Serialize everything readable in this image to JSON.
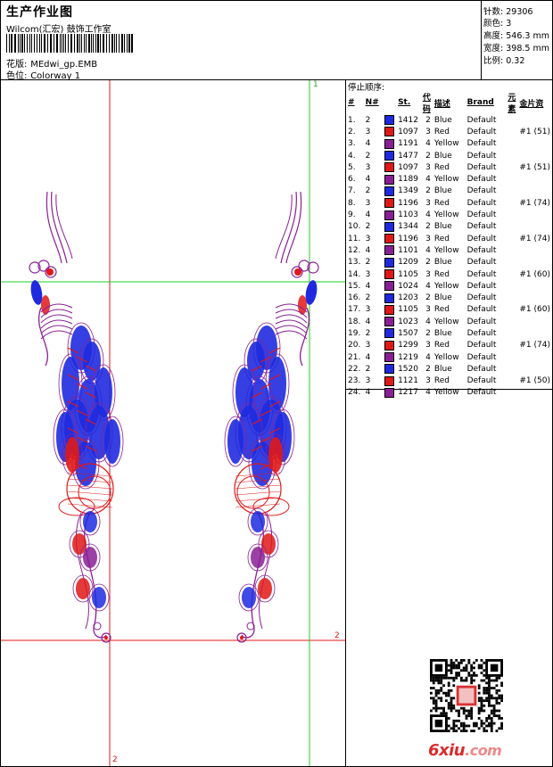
{
  "header": {
    "title": "生产作业图",
    "company": "Wilcom(汇宏) 鼓饰工作室",
    "design_label": "花版:",
    "design_value": "MEdwi_gp.EMB",
    "colorway_label": "色位:",
    "colorway_value": "Colorway 1"
  },
  "stats": {
    "stitches_label": "针数:",
    "stitches_value": "29306",
    "colors_label": "颜色:",
    "colors_value": "3",
    "height_label": "高度:",
    "height_value": "546.3 mm",
    "width_label": "宽度:",
    "width_value": "398.5 mm",
    "scale_label": "比例:",
    "scale_value": "0.32"
  },
  "canvas": {
    "marker_top": "1",
    "marker_right": "2",
    "marker_bottom": "2"
  },
  "stop_list": {
    "title": "停止顺序:",
    "headers": {
      "idx": "#",
      "n": "N#",
      "st": "St.",
      "code": "代码",
      "desc": "描述",
      "brand": "Brand",
      "element": "元素",
      "sequin": "金片资"
    },
    "rows": [
      {
        "idx": "1.",
        "n": "2",
        "color": "#1f2adf",
        "st": "1412",
        "code": "2",
        "desc": "Blue",
        "brand": "Default",
        "sequin": ""
      },
      {
        "idx": "2.",
        "n": "3",
        "color": "#e01818",
        "st": "1097",
        "code": "3",
        "desc": "Red",
        "brand": "Default",
        "sequin": "#1 (51)"
      },
      {
        "idx": "3.",
        "n": "4",
        "color": "#8a1f95",
        "st": "1191",
        "code": "4",
        "desc": "Yellow",
        "brand": "Default",
        "sequin": ""
      },
      {
        "idx": "4.",
        "n": "2",
        "color": "#1f2adf",
        "st": "1477",
        "code": "2",
        "desc": "Blue",
        "brand": "Default",
        "sequin": ""
      },
      {
        "idx": "5.",
        "n": "3",
        "color": "#e01818",
        "st": "1097",
        "code": "3",
        "desc": "Red",
        "brand": "Default",
        "sequin": "#1 (51)"
      },
      {
        "idx": "6.",
        "n": "4",
        "color": "#8a1f95",
        "st": "1189",
        "code": "4",
        "desc": "Yellow",
        "brand": "Default",
        "sequin": ""
      },
      {
        "idx": "7.",
        "n": "2",
        "color": "#1f2adf",
        "st": "1349",
        "code": "2",
        "desc": "Blue",
        "brand": "Default",
        "sequin": ""
      },
      {
        "idx": "8.",
        "n": "3",
        "color": "#e01818",
        "st": "1196",
        "code": "3",
        "desc": "Red",
        "brand": "Default",
        "sequin": "#1 (74)"
      },
      {
        "idx": "9.",
        "n": "4",
        "color": "#8a1f95",
        "st": "1103",
        "code": "4",
        "desc": "Yellow",
        "brand": "Default",
        "sequin": ""
      },
      {
        "idx": "10.",
        "n": "2",
        "color": "#1f2adf",
        "st": "1344",
        "code": "2",
        "desc": "Blue",
        "brand": "Default",
        "sequin": ""
      },
      {
        "idx": "11.",
        "n": "3",
        "color": "#e01818",
        "st": "1196",
        "code": "3",
        "desc": "Red",
        "brand": "Default",
        "sequin": "#1 (74)"
      },
      {
        "idx": "12.",
        "n": "4",
        "color": "#8a1f95",
        "st": "1101",
        "code": "4",
        "desc": "Yellow",
        "brand": "Default",
        "sequin": ""
      },
      {
        "idx": "13.",
        "n": "2",
        "color": "#1f2adf",
        "st": "1209",
        "code": "2",
        "desc": "Blue",
        "brand": "Default",
        "sequin": ""
      },
      {
        "idx": "14.",
        "n": "3",
        "color": "#e01818",
        "st": "1105",
        "code": "3",
        "desc": "Red",
        "brand": "Default",
        "sequin": "#1 (60)"
      },
      {
        "idx": "15.",
        "n": "4",
        "color": "#8a1f95",
        "st": "1024",
        "code": "4",
        "desc": "Yellow",
        "brand": "Default",
        "sequin": ""
      },
      {
        "idx": "16.",
        "n": "2",
        "color": "#1f2adf",
        "st": "1203",
        "code": "2",
        "desc": "Blue",
        "brand": "Default",
        "sequin": ""
      },
      {
        "idx": "17.",
        "n": "3",
        "color": "#e01818",
        "st": "1105",
        "code": "3",
        "desc": "Red",
        "brand": "Default",
        "sequin": "#1 (60)"
      },
      {
        "idx": "18.",
        "n": "4",
        "color": "#8a1f95",
        "st": "1023",
        "code": "4",
        "desc": "Yellow",
        "brand": "Default",
        "sequin": ""
      },
      {
        "idx": "19.",
        "n": "2",
        "color": "#1f2adf",
        "st": "1507",
        "code": "2",
        "desc": "Blue",
        "brand": "Default",
        "sequin": ""
      },
      {
        "idx": "20.",
        "n": "3",
        "color": "#e01818",
        "st": "1299",
        "code": "3",
        "desc": "Red",
        "brand": "Default",
        "sequin": "#1 (74)"
      },
      {
        "idx": "21.",
        "n": "4",
        "color": "#8a1f95",
        "st": "1219",
        "code": "4",
        "desc": "Yellow",
        "brand": "Default",
        "sequin": ""
      },
      {
        "idx": "22.",
        "n": "2",
        "color": "#1f2adf",
        "st": "1520",
        "code": "2",
        "desc": "Blue",
        "brand": "Default",
        "sequin": ""
      },
      {
        "idx": "23.",
        "n": "3",
        "color": "#e01818",
        "st": "1121",
        "code": "3",
        "desc": "Red",
        "brand": "Default",
        "sequin": "#1 (50)"
      },
      {
        "idx": "24.",
        "n": "4",
        "color": "#8a1f95",
        "st": "1217",
        "code": "4",
        "desc": "Yellow",
        "brand": "Default",
        "sequin": ""
      }
    ]
  },
  "footer": {
    "logo_text": "6xiu",
    "logo_domain": ".com"
  },
  "colors": {
    "guide_red": "#e01818",
    "guide_green": "#22cc22",
    "thread_blue": "#1f2adf",
    "thread_red": "#e01818",
    "thread_purple": "#8a1f95"
  }
}
